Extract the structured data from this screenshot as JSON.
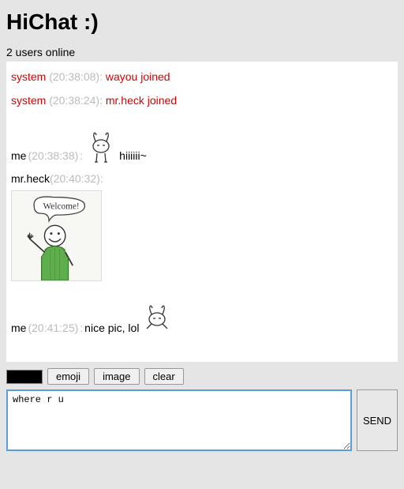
{
  "header": {
    "title": "HiChat :)"
  },
  "status": {
    "text": "2 users online"
  },
  "messages": [
    {
      "kind": "system",
      "sender": "system",
      "time": "(20:38:08)",
      "content": "wayou joined"
    },
    {
      "kind": "system",
      "sender": "system",
      "time": "(20:38:24)",
      "content": "mr.heck joined"
    },
    {
      "kind": "user",
      "sender": "me",
      "time": "(20:38:38)",
      "pre_emoji": "bunny",
      "content": "hiiiiii~"
    },
    {
      "kind": "user",
      "sender": "mr.heck",
      "time": "(20:40:32)",
      "image": "welcome-drawing",
      "content": ""
    },
    {
      "kind": "user",
      "sender": "me",
      "time": "(20:41:25)",
      "content": "nice pic, lol",
      "post_emoji": "bunny"
    }
  ],
  "toolbar": {
    "color": "#000000",
    "emoji_label": "emoji",
    "image_label": "image",
    "clear_label": "clear"
  },
  "compose": {
    "value": "where r u",
    "placeholder": ""
  },
  "send": {
    "label": "SEND"
  }
}
